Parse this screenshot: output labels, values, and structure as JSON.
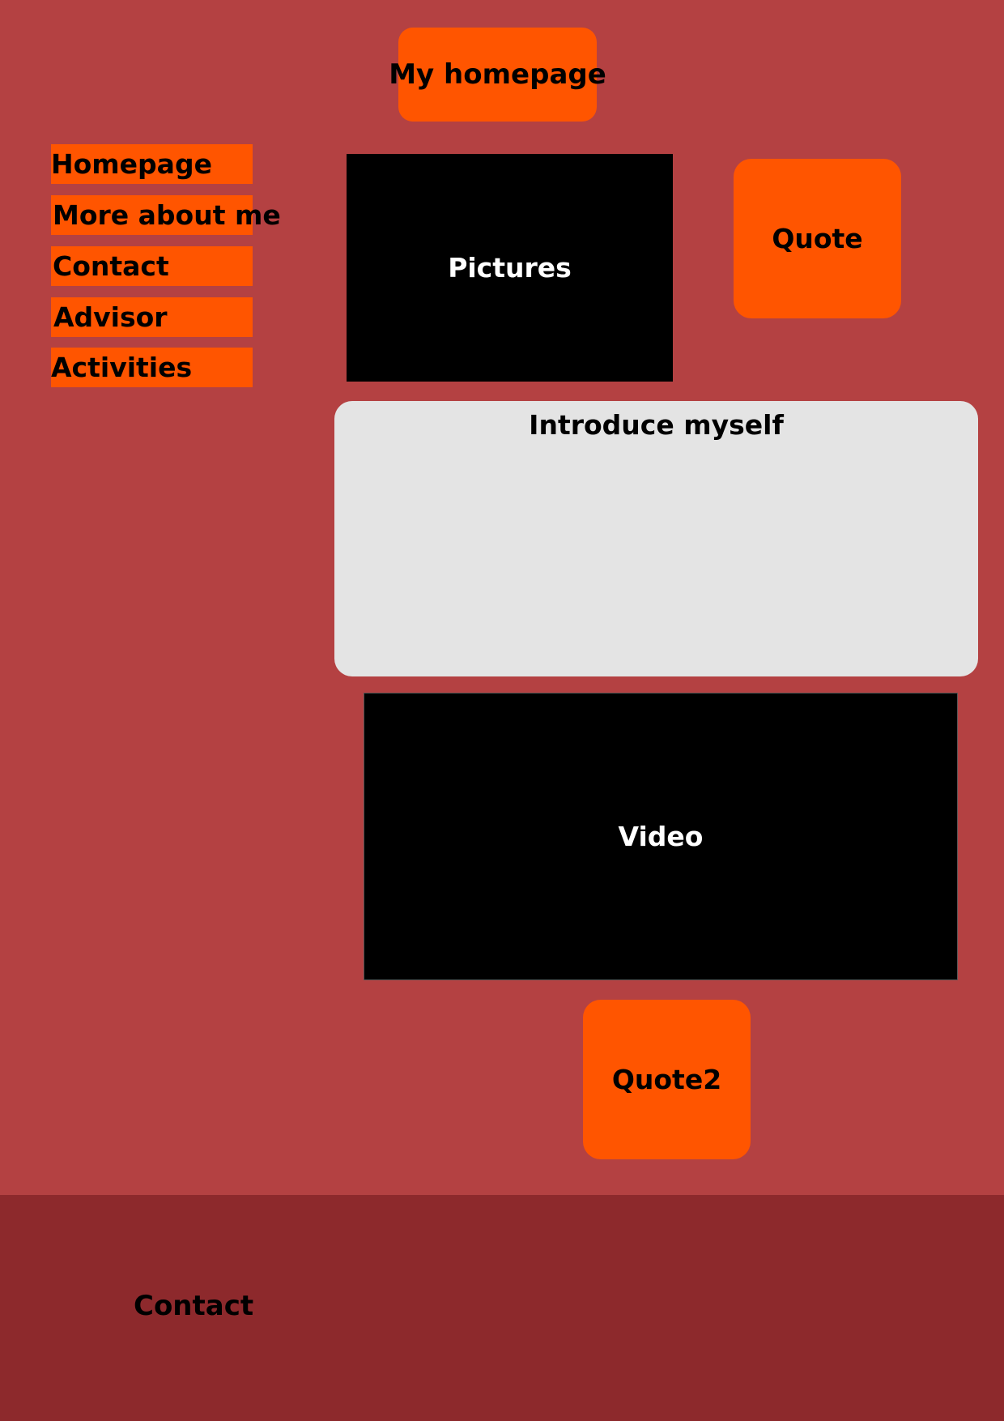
{
  "header": {
    "title": "My homepage"
  },
  "nav": {
    "items": [
      {
        "label": "Homepage"
      },
      {
        "label": "More about me"
      },
      {
        "label": "Contact"
      },
      {
        "label": "Advisor"
      },
      {
        "label": "Activities"
      }
    ]
  },
  "main": {
    "pictures_label": "Pictures",
    "quote_label": "Quote",
    "intro_heading": "Introduce myself",
    "video_label": "Video",
    "quote2_label": "Quote2"
  },
  "footer": {
    "label": "Contact"
  },
  "colors": {
    "page_background": "#b44142",
    "accent": "#ff5500",
    "footer_background": "#8d292c",
    "panel_background": "#e4e4e4",
    "media_background": "#000000"
  }
}
